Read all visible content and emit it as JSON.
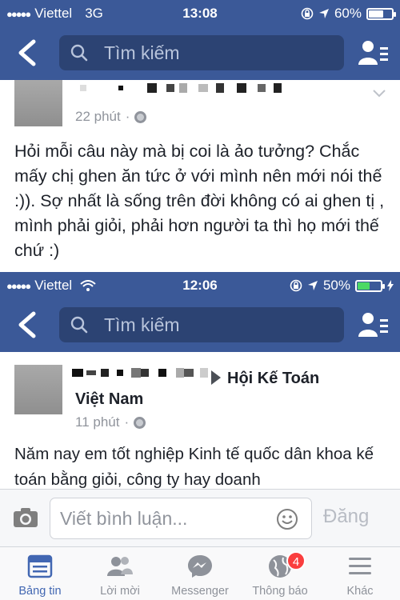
{
  "screenshot1": {
    "status": {
      "carrier": "Viettel",
      "network": "3G",
      "time": "13:08",
      "battery": "60%",
      "battery_level": 0.6
    },
    "search": {
      "placeholder": "Tìm kiếm"
    },
    "post": {
      "time": "22 phút",
      "text": "Hỏi mỗi câu này mà bị coi là ảo tưởng? Chắc mấy chị ghen ăn tức ở với mình nên mới nói thế :)). Sợ nhất là sống trên đời không có ai ghen tị , mình phải giỏi, phải hơn người ta thì họ mới thế chứ :)"
    }
  },
  "screenshot2": {
    "status": {
      "carrier": "Viettel",
      "time": "12:06",
      "battery": "50%",
      "battery_level": 0.5
    },
    "search": {
      "placeholder": "Tìm kiếm"
    },
    "post": {
      "group_line1": "Hội Kế Toán",
      "group_line2": "Việt Nam",
      "time": "11 phút",
      "text": "Năm nay em tốt nghiệp Kinh tế quốc dân khoa kế toán bằng giỏi, công ty hay doanh"
    },
    "comment": {
      "placeholder": "Viết bình luận...",
      "post_label": "Đăng"
    },
    "tabs": [
      {
        "label": "Bảng tin",
        "icon": "news-feed-icon",
        "active": true
      },
      {
        "label": "Lời mời",
        "icon": "friend-requests-icon"
      },
      {
        "label": "Messenger",
        "icon": "messenger-icon"
      },
      {
        "label": "Thông báo",
        "icon": "globe-notifications-icon",
        "badge": "4"
      },
      {
        "label": "Khác",
        "icon": "menu-icon"
      }
    ]
  },
  "colors": {
    "facebook_blue": "#3b5998",
    "search_bg": "#2c4373",
    "active_tab": "#4267b2",
    "badge_red": "#fa3e3e"
  }
}
